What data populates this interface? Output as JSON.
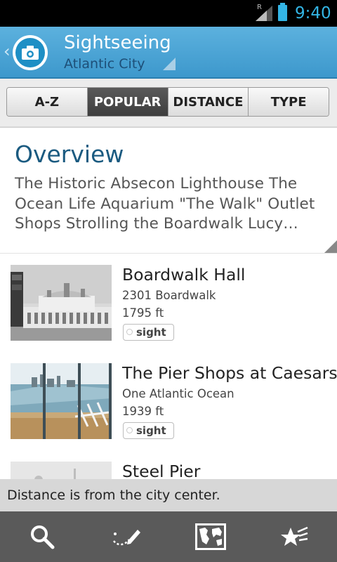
{
  "status_bar": {
    "time": "9:40",
    "signal_label": "R"
  },
  "action_bar": {
    "title": "Sightseeing",
    "subtitle": "Atlantic City",
    "icons": {
      "back": "chevron-left-icon",
      "app": "camera-icon",
      "dropdown": "dropdown-corner-icon"
    }
  },
  "tabs": [
    {
      "label": "A-Z",
      "active": false
    },
    {
      "label": "POPULAR",
      "active": true
    },
    {
      "label": "DISTANCE",
      "active": false
    },
    {
      "label": "TYPE",
      "active": false
    }
  ],
  "overview": {
    "title": "Overview",
    "text": "The Historic Absecon Lighthouse  The Ocean Life Aquarium  \"The Walk\" Outlet Shops  Strolling the Boardwalk  Lucy…"
  },
  "list": [
    {
      "name": "Boardwalk Hall",
      "address": "2301 Boardwalk",
      "distance": "1795 ft",
      "tag": "sight"
    },
    {
      "name": "The Pier Shops at Caesars",
      "address": "One Atlantic Ocean",
      "distance": "1939 ft",
      "tag": "sight"
    },
    {
      "name": "Steel Pier",
      "address": "",
      "distance": "",
      "tag": ""
    }
  ],
  "toast": {
    "text": "Distance is from the city center."
  },
  "bottom_bar": {
    "icons": [
      "search-icon",
      "route-edit-icon",
      "map-icon",
      "favorites-icon"
    ]
  },
  "colors": {
    "accent": "#33b5e5",
    "action_bar": "#4aa3d6",
    "overview_title": "#1a5a80",
    "tab_active": "#4a4a4a",
    "bottom_bar": "#5a5a5a"
  }
}
